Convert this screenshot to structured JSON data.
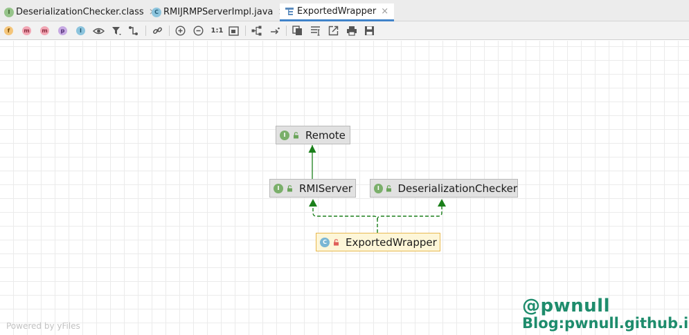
{
  "tabs": [
    {
      "icon": "interface-icon",
      "icon_letter": "I",
      "label": "DeserializationChecker.class",
      "close": "×",
      "active": false
    },
    {
      "icon": "class-icon",
      "icon_letter": "C",
      "label": "RMIJRMPServerImpl.java",
      "close": "×",
      "active": false
    },
    {
      "icon": "diagram-icon",
      "label": "ExportedWrapper",
      "close": "×",
      "active": true
    }
  ],
  "toolbar": {
    "fields_badge": "f",
    "constructors_badge": "m",
    "methods_badge": "m",
    "properties_badge": "p",
    "inner_classes_badge": "I",
    "actual_size_label": "1:1"
  },
  "diagram": {
    "nodes": {
      "remote": {
        "icon_letter": "I",
        "label": "Remote",
        "kind": "interface"
      },
      "rmiserver": {
        "icon_letter": "I",
        "label": "RMIServer",
        "kind": "interface"
      },
      "deserialization_checker": {
        "icon_letter": "I",
        "label": "DeserializationChecker",
        "kind": "interface"
      },
      "exported_wrapper": {
        "icon_letter": "C",
        "label": "ExportedWrapper",
        "kind": "class",
        "selected": true
      }
    },
    "colors": {
      "inheritance_arrow": "#1a7f1a",
      "implements_dashed": "#1a7f1a",
      "node_fill": "#e1e1e1",
      "selected_fill": "#fdf6d8",
      "selected_border": "#e8b84e"
    }
  },
  "footer": {
    "powered_by": "Powered by yFiles"
  },
  "watermark": {
    "line1": "@pwnull",
    "line2": "Blog:pwnull.github.io"
  }
}
